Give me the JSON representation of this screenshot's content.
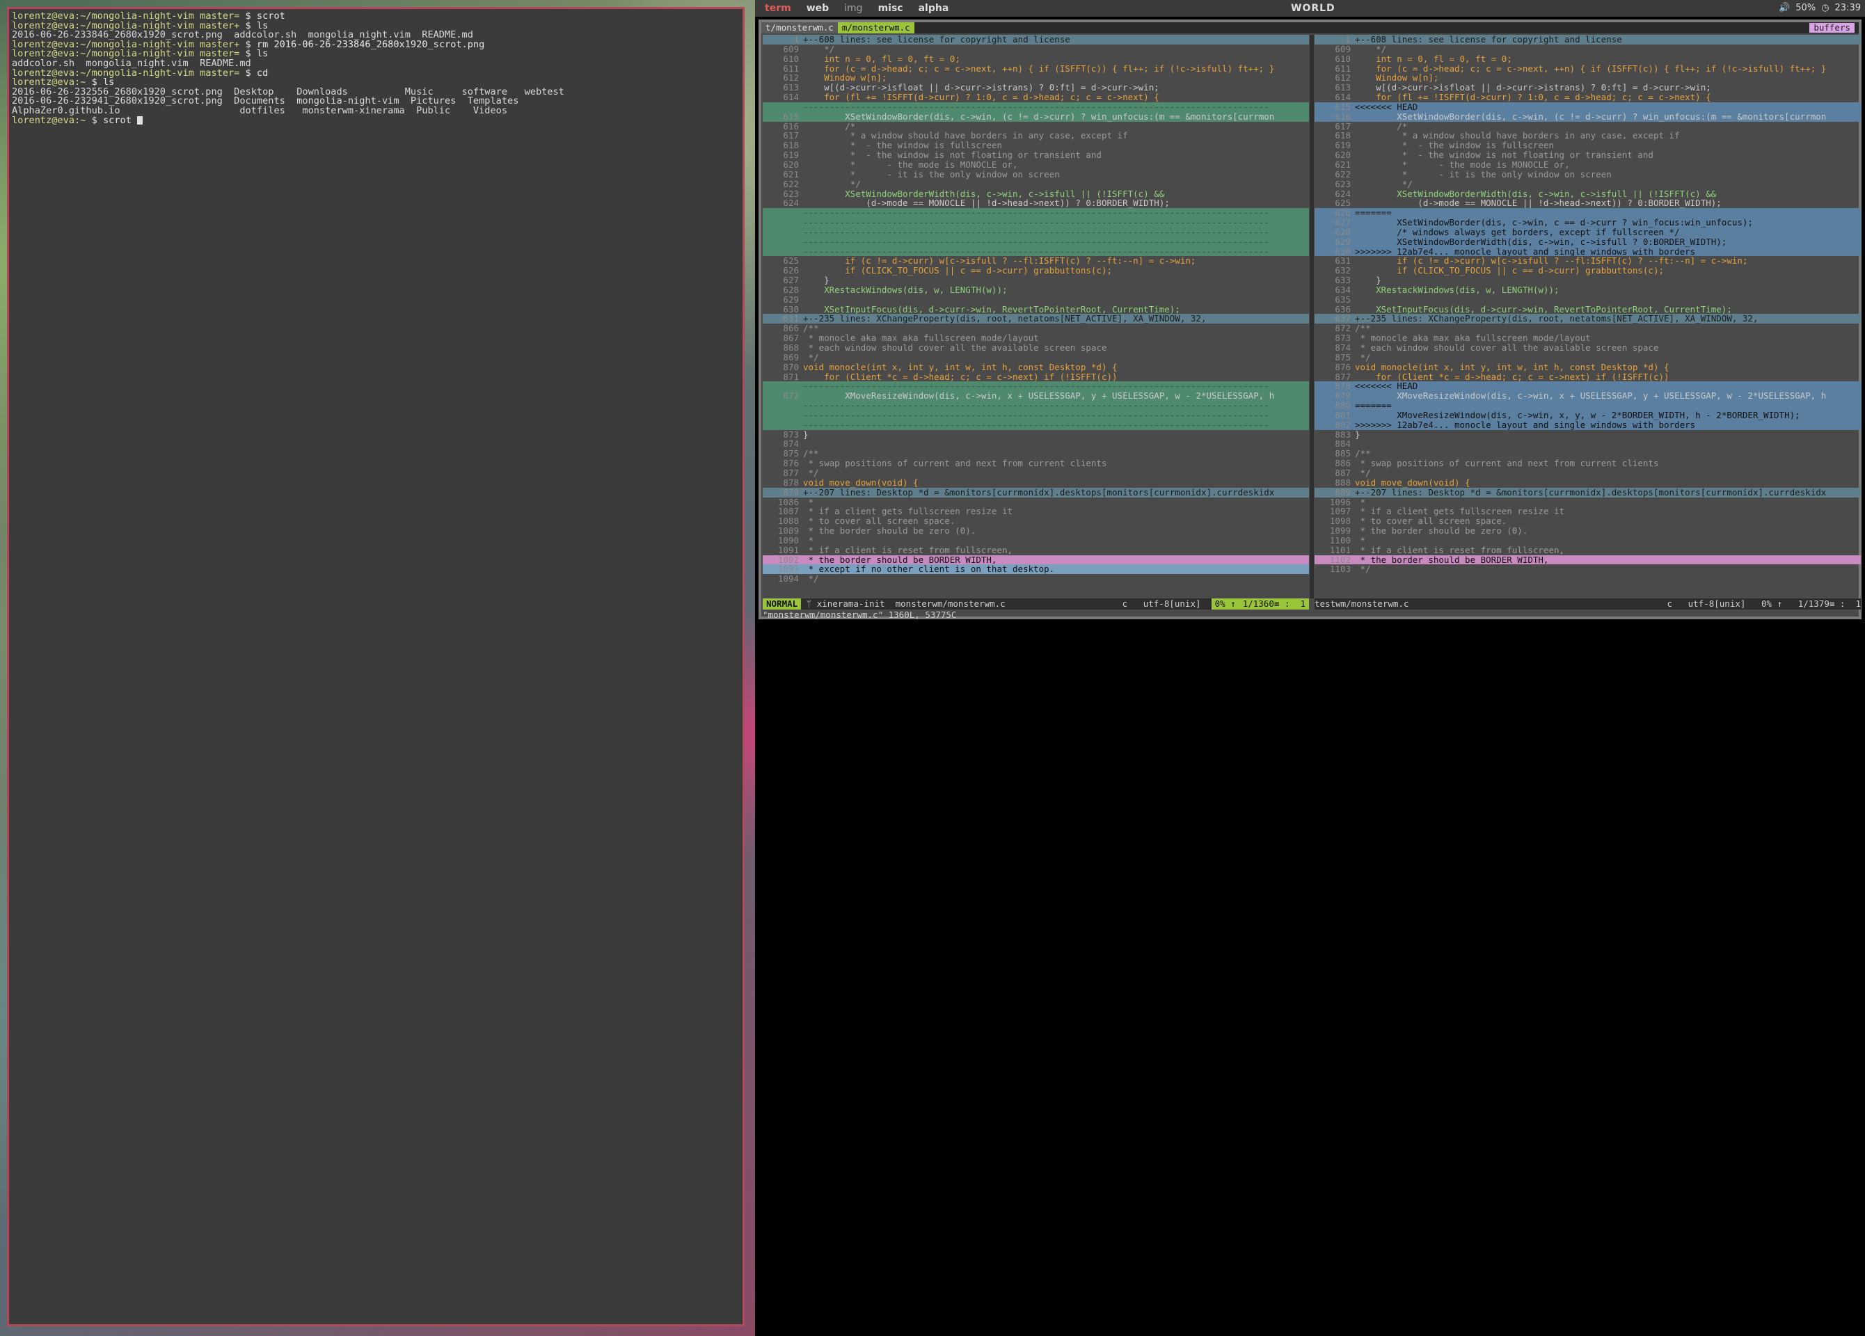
{
  "topbar": {
    "workspaces": [
      "term",
      "web",
      "img",
      "misc",
      "alpha"
    ],
    "active_workspace": "term",
    "title": "WORLD",
    "volume": "50%",
    "clock": "23:39"
  },
  "terminal": {
    "lines": [
      {
        "prompt": "lorentz@eva:~/mongolia-night-vim master=",
        "cmd": " $ scrot"
      },
      {
        "prompt": "lorentz@eva:~/mongolia-night-vim master+",
        "cmd": " $ ls"
      },
      {
        "text": "2016-06-26-233846_2680x1920_scrot.png  addcolor.sh  mongolia_night.vim  README.md"
      },
      {
        "prompt": "lorentz@eva:~/mongolia-night-vim master+",
        "cmd": " $ rm 2016-06-26-233846_2680x1920_scrot.png"
      },
      {
        "prompt": "lorentz@eva:~/mongolia-night-vim master=",
        "cmd": " $ ls"
      },
      {
        "text": "addcolor.sh  mongolia_night.vim  README.md"
      },
      {
        "prompt": "lorentz@eva:~/mongolia-night-vim master=",
        "cmd": " $ cd"
      },
      {
        "prompt": "lorentz@eva:~",
        "cmd": " $ ls"
      },
      {
        "text": "2016-06-26-232556_2680x1920_scrot.png  Desktop    Downloads          Music     software   webtest"
      },
      {
        "text": "2016-06-26-232941_2680x1920_scrot.png  Documents  mongolia-night-vim  Pictures  Templates"
      },
      {
        "text": "AlphaZer0.github.io                     dotfiles   monsterwm-xinerama  Public    Videos"
      },
      {
        "prompt": "lorentz@eva:~",
        "cmd": " $ scrot "
      }
    ]
  },
  "vim": {
    "tabs": [
      "t/monsterwm.c",
      "m/monsterwm.c"
    ],
    "buffers_label": "buffers",
    "left_lines": [
      {
        "n": "1",
        "t": "+--608 lines: see license for copyright and license",
        "k": "fold"
      },
      {
        "n": "609",
        "t": "    */",
        "k": ""
      },
      {
        "n": "610",
        "t": "    int n = 0, fl = 0, ft = 0;",
        "k": ""
      },
      {
        "n": "611",
        "t": "    for (c = d->head; c; c = c->next, ++n) { if (ISFFT(c)) { fl++; if (!c->isfull) ft++; }",
        "k": ""
      },
      {
        "n": "612",
        "t": "    Window w[n];",
        "k": ""
      },
      {
        "n": "613",
        "t": "    w[(d->curr->isfloat || d->curr->istrans) ? 0:ft] = d->curr->win;",
        "k": ""
      },
      {
        "n": "614",
        "t": "    for (fl += !ISFFT(d->curr) ? 1:0, c = d->head; c; c = c->next) {",
        "k": ""
      },
      {
        "n": "",
        "t": "-----------------------------------------------------------------------------------------",
        "k": "del"
      },
      {
        "n": "615",
        "t": "        XSetWindowBorder(dis, c->win, (c != d->curr) ? win_unfocus:(m == &monitors[currmon",
        "k": "add"
      },
      {
        "n": "616",
        "t": "        /*",
        "k": ""
      },
      {
        "n": "617",
        "t": "         * a window should have borders in any case, except if",
        "k": ""
      },
      {
        "n": "618",
        "t": "         *  - the window is fullscreen",
        "k": ""
      },
      {
        "n": "619",
        "t": "         *  - the window is not floating or transient and",
        "k": ""
      },
      {
        "n": "620",
        "t": "         *      - the mode is MONOCLE or,",
        "k": ""
      },
      {
        "n": "621",
        "t": "         *      - it is the only window on screen",
        "k": ""
      },
      {
        "n": "622",
        "t": "         */",
        "k": ""
      },
      {
        "n": "623",
        "t": "        XSetWindowBorderWidth(dis, c->win, c->isfull || (!ISFFT(c) &&",
        "k": ""
      },
      {
        "n": "624",
        "t": "            (d->mode == MONOCLE || !d->head->next)) ? 0:BORDER_WIDTH);",
        "k": ""
      },
      {
        "n": "",
        "t": "-----------------------------------------------------------------------------------------",
        "k": "del"
      },
      {
        "n": "",
        "t": "-----------------------------------------------------------------------------------------",
        "k": "del"
      },
      {
        "n": "",
        "t": "-----------------------------------------------------------------------------------------",
        "k": "del"
      },
      {
        "n": "",
        "t": "-----------------------------------------------------------------------------------------",
        "k": "del"
      },
      {
        "n": "",
        "t": "-----------------------------------------------------------------------------------------",
        "k": "del"
      },
      {
        "n": "625",
        "t": "        if (c != d->curr) w[c->isfull ? --fl:ISFFT(c) ? --ft:--n] = c->win;",
        "k": ""
      },
      {
        "n": "626",
        "t": "        if (CLICK_TO_FOCUS || c == d->curr) grabbuttons(c);",
        "k": ""
      },
      {
        "n": "627",
        "t": "    }",
        "k": ""
      },
      {
        "n": "628",
        "t": "    XRestackWindows(dis, w, LENGTH(w));",
        "k": ""
      },
      {
        "n": "629",
        "t": "",
        "k": ""
      },
      {
        "n": "630",
        "t": "    XSetInputFocus(dis, d->curr->win, RevertToPointerRoot, CurrentTime);",
        "k": ""
      },
      {
        "n": "631",
        "t": "+--235 lines: XChangeProperty(dis, root, netatoms[NET_ACTIVE], XA_WINDOW, 32,",
        "k": "fold"
      },
      {
        "n": "866",
        "t": "/**",
        "k": ""
      },
      {
        "n": "867",
        "t": " * monocle aka max aka fullscreen mode/layout",
        "k": ""
      },
      {
        "n": "868",
        "t": " * each window should cover all the available screen space",
        "k": ""
      },
      {
        "n": "869",
        "t": " */",
        "k": ""
      },
      {
        "n": "870",
        "t": "void monocle(int x, int y, int w, int h, const Desktop *d) {",
        "k": ""
      },
      {
        "n": "871",
        "t": "    for (Client *c = d->head; c; c = c->next) if (!ISFFT(c))",
        "k": ""
      },
      {
        "n": "",
        "t": "-----------------------------------------------------------------------------------------",
        "k": "del"
      },
      {
        "n": "872",
        "t": "        XMoveResizeWindow(dis, c->win, x + USELESSGAP, y + USELESSGAP, w - 2*USELESSGAP, h",
        "k": "add"
      },
      {
        "n": "",
        "t": "-----------------------------------------------------------------------------------------",
        "k": "del"
      },
      {
        "n": "",
        "t": "-----------------------------------------------------------------------------------------",
        "k": "del"
      },
      {
        "n": "",
        "t": "-----------------------------------------------------------------------------------------",
        "k": "del"
      },
      {
        "n": "873",
        "t": "}",
        "k": ""
      },
      {
        "n": "874",
        "t": "",
        "k": ""
      },
      {
        "n": "875",
        "t": "/**",
        "k": ""
      },
      {
        "n": "876",
        "t": " * swap positions of current and next from current clients",
        "k": ""
      },
      {
        "n": "877",
        "t": " */",
        "k": ""
      },
      {
        "n": "878",
        "t": "void move_down(void) {",
        "k": ""
      },
      {
        "n": "879",
        "t": "+--207 lines: Desktop *d = &monitors[currmonidx].desktops[monitors[currmonidx].currdeskidx",
        "k": "fold"
      },
      {
        "n": "1086",
        "t": " *",
        "k": ""
      },
      {
        "n": "1087",
        "t": " * if a client gets fullscreen resize it",
        "k": ""
      },
      {
        "n": "1088",
        "t": " * to cover all screen space.",
        "k": ""
      },
      {
        "n": "1089",
        "t": " * the border should be zero (0).",
        "k": ""
      },
      {
        "n": "1090",
        "t": " *",
        "k": ""
      },
      {
        "n": "1091",
        "t": " * if a client is reset from fullscreen,",
        "k": ""
      },
      {
        "n": "1092",
        "t": " * the border should be BORDER_WIDTH,",
        "k": "hl"
      },
      {
        "n": "1093",
        "t": " * except if no other client is on that desktop.",
        "k": "sel2"
      },
      {
        "n": "1094",
        "t": " */",
        "k": ""
      }
    ],
    "right_lines": [
      {
        "n": "1",
        "t": "+--608 lines: see license for copyright and license",
        "k": "fold"
      },
      {
        "n": "609",
        "t": "    */",
        "k": ""
      },
      {
        "n": "610",
        "t": "    int n = 0, fl = 0, ft = 0;",
        "k": ""
      },
      {
        "n": "611",
        "t": "    for (c = d->head; c; c = c->next, ++n) { if (ISFFT(c)) { fl++; if (!c->isfull) ft++; }",
        "k": ""
      },
      {
        "n": "612",
        "t": "    Window w[n];",
        "k": ""
      },
      {
        "n": "613",
        "t": "    w[(d->curr->isfloat || d->curr->istrans) ? 0:ft] = d->curr->win;",
        "k": ""
      },
      {
        "n": "614",
        "t": "    for (fl += !ISFFT(d->curr) ? 1:0, c = d->head; c; c = c->next) {",
        "k": ""
      },
      {
        "n": "615",
        "t": "<<<<<<< HEAD",
        "k": "conf"
      },
      {
        "n": "616",
        "t": "        XSetWindowBorder(dis, c->win, (c != d->curr) ? win_unfocus:(m == &monitors[currmon",
        "k": "chg"
      },
      {
        "n": "617",
        "t": "        /*",
        "k": ""
      },
      {
        "n": "618",
        "t": "         * a window should have borders in any case, except if",
        "k": ""
      },
      {
        "n": "619",
        "t": "         *  - the window is fullscreen",
        "k": ""
      },
      {
        "n": "620",
        "t": "         *  - the window is not floating or transient and",
        "k": ""
      },
      {
        "n": "621",
        "t": "         *      - the mode is MONOCLE or,",
        "k": ""
      },
      {
        "n": "622",
        "t": "         *      - it is the only window on screen",
        "k": ""
      },
      {
        "n": "623",
        "t": "         */",
        "k": ""
      },
      {
        "n": "624",
        "t": "        XSetWindowBorderWidth(dis, c->win, c->isfull || (!ISFFT(c) &&",
        "k": ""
      },
      {
        "n": "625",
        "t": "            (d->mode == MONOCLE || !d->head->next)) ? 0:BORDER_WIDTH);",
        "k": ""
      },
      {
        "n": "626",
        "t": "=======",
        "k": "conf"
      },
      {
        "n": "627",
        "t": "        XSetWindowBorder(dis, c->win, c == d->curr ? win_focus:win_unfocus);",
        "k": "conf"
      },
      {
        "n": "628",
        "t": "        /* windows always get borders, except if fullscreen */",
        "k": "conf"
      },
      {
        "n": "629",
        "t": "        XSetWindowBorderWidth(dis, c->win, c->isfull ? 0:BORDER_WIDTH);",
        "k": "conf"
      },
      {
        "n": "630",
        "t": ">>>>>>> 12ab7e4... monocle layout and single windows with borders",
        "k": "conf"
      },
      {
        "n": "631",
        "t": "        if (c != d->curr) w[c->isfull ? --fl:ISFFT(c) ? --ft:--n] = c->win;",
        "k": ""
      },
      {
        "n": "632",
        "t": "        if (CLICK_TO_FOCUS || c == d->curr) grabbuttons(c);",
        "k": ""
      },
      {
        "n": "633",
        "t": "    }",
        "k": ""
      },
      {
        "n": "634",
        "t": "    XRestackWindows(dis, w, LENGTH(w));",
        "k": ""
      },
      {
        "n": "635",
        "t": "",
        "k": ""
      },
      {
        "n": "636",
        "t": "    XSetInputFocus(dis, d->curr->win, RevertToPointerRoot, CurrentTime);",
        "k": ""
      },
      {
        "n": "637",
        "t": "+--235 lines: XChangeProperty(dis, root, netatoms[NET_ACTIVE], XA_WINDOW, 32,",
        "k": "fold"
      },
      {
        "n": "872",
        "t": "/**",
        "k": ""
      },
      {
        "n": "873",
        "t": " * monocle aka max aka fullscreen mode/layout",
        "k": ""
      },
      {
        "n": "874",
        "t": " * each window should cover all the available screen space",
        "k": ""
      },
      {
        "n": "875",
        "t": " */",
        "k": ""
      },
      {
        "n": "876",
        "t": "void monocle(int x, int y, int w, int h, const Desktop *d) {",
        "k": ""
      },
      {
        "n": "877",
        "t": "    for (Client *c = d->head; c; c = c->next) if (!ISFFT(c))",
        "k": ""
      },
      {
        "n": "878",
        "t": "<<<<<<< HEAD",
        "k": "conf"
      },
      {
        "n": "879",
        "t": "        XMoveResizeWindow(dis, c->win, x + USELESSGAP, y + USELESSGAP, w - 2*USELESSGAP, h",
        "k": "chg"
      },
      {
        "n": "880",
        "t": "=======",
        "k": "conf"
      },
      {
        "n": "881",
        "t": "        XMoveResizeWindow(dis, c->win, x, y, w - 2*BORDER_WIDTH, h - 2*BORDER_WIDTH);",
        "k": "conf"
      },
      {
        "n": "882",
        "t": ">>>>>>> 12ab7e4... monocle layout and single windows with borders",
        "k": "conf"
      },
      {
        "n": "883",
        "t": "}",
        "k": ""
      },
      {
        "n": "884",
        "t": "",
        "k": ""
      },
      {
        "n": "885",
        "t": "/**",
        "k": ""
      },
      {
        "n": "886",
        "t": " * swap positions of current and next from current clients",
        "k": ""
      },
      {
        "n": "887",
        "t": " */",
        "k": ""
      },
      {
        "n": "888",
        "t": "void move_down(void) {",
        "k": ""
      },
      {
        "n": "889",
        "t": "+--207 lines: Desktop *d = &monitors[currmonidx].desktops[monitors[currmonidx].currdeskidx",
        "k": "fold"
      },
      {
        "n": "1096",
        "t": " *",
        "k": ""
      },
      {
        "n": "1097",
        "t": " * if a client gets fullscreen resize it",
        "k": ""
      },
      {
        "n": "1098",
        "t": " * to cover all screen space.",
        "k": ""
      },
      {
        "n": "1099",
        "t": " * the border should be zero (0).",
        "k": ""
      },
      {
        "n": "1100",
        "t": " *",
        "k": ""
      },
      {
        "n": "1101",
        "t": " * if a client is reset from fullscreen,",
        "k": ""
      },
      {
        "n": "1102",
        "t": " * the border should be BORDER_WIDTH,",
        "k": "hl"
      },
      {
        "n": "1103",
        "t": " */",
        "k": ""
      }
    ],
    "status_left": {
      "mode": "NORMAL",
      "branch": "xinerama-init",
      "file": "monsterwm/monsterwm.c",
      "ft": "c",
      "enc": "utf-8[unix]",
      "pct": "0% ↑",
      "pos": "1/1360≡ :  1"
    },
    "status_right": {
      "file": "testwm/monsterwm.c",
      "ft": "c",
      "enc": "utf-8[unix]",
      "pct": "0% ↑",
      "pos": "1/1379≡ :  1"
    },
    "cmdline": "\"monsterwm/monsterwm.c\" 1360L, 53775C"
  }
}
